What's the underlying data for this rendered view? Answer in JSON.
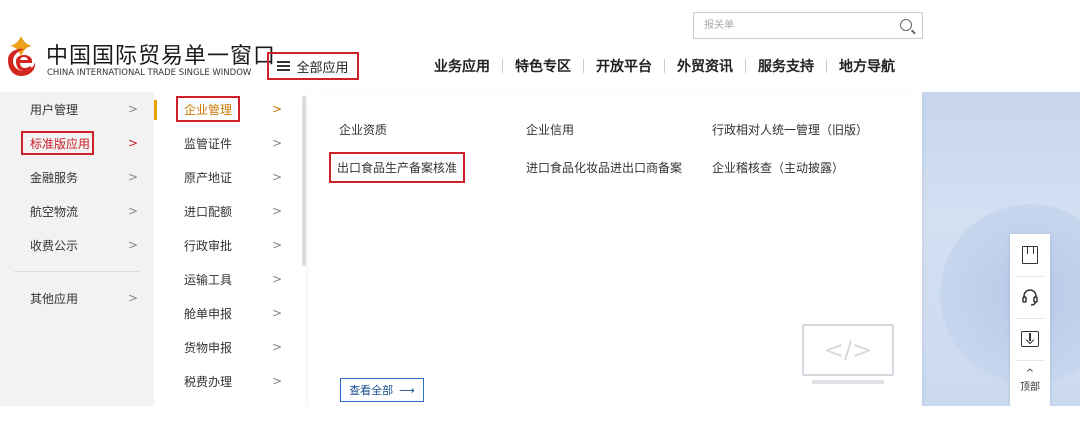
{
  "header": {
    "brand_cn": "中国国际贸易单一窗口",
    "brand_en": "CHINA INTERNATIONAL TRADE SINGLE WINDOW",
    "all_apps_label": "全部应用",
    "search_placeholder": "报关单",
    "nav": [
      "业务应用",
      "特色专区",
      "开放平台",
      "外贸资讯",
      "服务支持",
      "地方导航"
    ]
  },
  "categories": [
    {
      "label": "用户管理"
    },
    {
      "label": "标准版应用",
      "active": true
    },
    {
      "label": "金融服务"
    },
    {
      "label": "航空物流"
    },
    {
      "label": "收费公示"
    },
    {
      "label": "其他应用"
    }
  ],
  "subcategories": [
    {
      "label": "企业管理",
      "active": true
    },
    {
      "label": "监管证件"
    },
    {
      "label": "原产地证"
    },
    {
      "label": "进口配额"
    },
    {
      "label": "行政审批"
    },
    {
      "label": "运输工具"
    },
    {
      "label": "舱单申报"
    },
    {
      "label": "货物申报"
    },
    {
      "label": "税费办理"
    }
  ],
  "panel": {
    "links": [
      "企业资质",
      "企业信用",
      "行政相对人统一管理（旧版）",
      "出口食品生产备案核准",
      "进口食品化妆品进出口商备案",
      "企业稽核查（主动披露）"
    ],
    "code_symbol": "</>",
    "view_all": "查看全部",
    "view_all_arrow": "⟶"
  },
  "float_bar": {
    "top_label": "顶部",
    "top_caret": "^"
  },
  "chevron": ">",
  "colors": {
    "accent_red": "#d0202a",
    "accent_orange": "#e8a000",
    "link_blue": "#2a6fc9"
  }
}
